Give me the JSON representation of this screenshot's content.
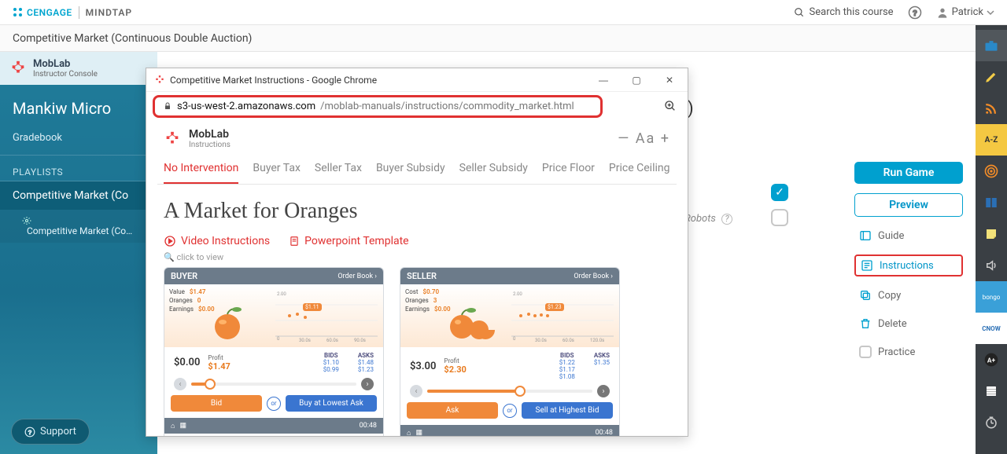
{
  "topbar": {
    "brand1": "CENGAGE",
    "brand2": "MINDTAP",
    "search_placeholder": "Search this course",
    "user_name": "Patrick"
  },
  "subheader": {
    "title": "Competitive Market (Continuous Double Auction)"
  },
  "sidebar": {
    "app_name": "MobLab",
    "app_sub": "Instructor Console",
    "course": "Mankiw Micro",
    "gradebook": "Gradebook",
    "playlists_label": "PLAYLISTS",
    "item_active": "Competitive Market (Co",
    "subitem": "Competitive Market (Co…",
    "support": "Support"
  },
  "content": {
    "robots_label": "Robots",
    "paren": ")"
  },
  "actions": {
    "run": "Run Game",
    "preview": "Preview",
    "guide": "Guide",
    "instructions": "Instructions",
    "copy": "Copy",
    "delete": "Delete",
    "practice": "Practice"
  },
  "toolrail": {
    "items": [
      "briefcase",
      "highlighter",
      "rss",
      "a-z",
      "target",
      "book",
      "sticky",
      "speak",
      "bongo",
      "cnow",
      "aplus",
      "notes",
      "clock"
    ]
  },
  "chrome": {
    "title": "Competitive Market Instructions - Google Chrome",
    "url_host": "s3-us-west-2.amazonaws.com",
    "url_path": "/moblab-manuals/instructions/commodity_market.html",
    "ml_name": "MobLab",
    "ml_sub": "Instructions",
    "tabs": [
      "No Intervention",
      "Buyer Tax",
      "Seller Tax",
      "Buyer Subsidy",
      "Seller Subsidy",
      "Price Floor",
      "Price Ceiling"
    ],
    "active_tab": 0,
    "page_title": "A Market for Oranges",
    "link_video": "Video Instructions",
    "link_ppt": "Powerpoint Template",
    "hint": "click to view",
    "buyer": {
      "head": "BUYER",
      "orderbook": "Order Book ›",
      "kv": [
        [
          "Value",
          "$1.47"
        ],
        [
          "Oranges",
          "0"
        ],
        [
          "Earnings",
          "$0.00"
        ]
      ],
      "price": "$0.00",
      "profit_label": "Profit",
      "profit": "$1.47",
      "bids_label": "BIDS",
      "asks_label": "ASKS",
      "bids": [
        "$1.10",
        "$0.99"
      ],
      "asks": [
        "$1.48",
        "$1.23"
      ],
      "bubble": "$1.11",
      "action": "Bid",
      "or": "or",
      "action2": "Buy at Lowest Ask",
      "time": "00:48"
    },
    "seller": {
      "head": "SELLER",
      "orderbook": "Order Book ›",
      "kv": [
        [
          "Cost",
          "$0.70"
        ],
        [
          "Oranges",
          "3"
        ],
        [
          "Earnings",
          "$0.00"
        ]
      ],
      "price": "$3.00",
      "profit_label": "Profit",
      "profit": "$2.30",
      "bids_label": "BIDS",
      "asks_label": "ASKS",
      "bids": [
        "$1.22",
        "$1.17",
        "$1.08"
      ],
      "asks": [
        "$1.35"
      ],
      "bubble": "$1.23",
      "action": "Ask",
      "or": "or",
      "action2": "Sell at Highest Bid",
      "time": "00:48"
    }
  }
}
